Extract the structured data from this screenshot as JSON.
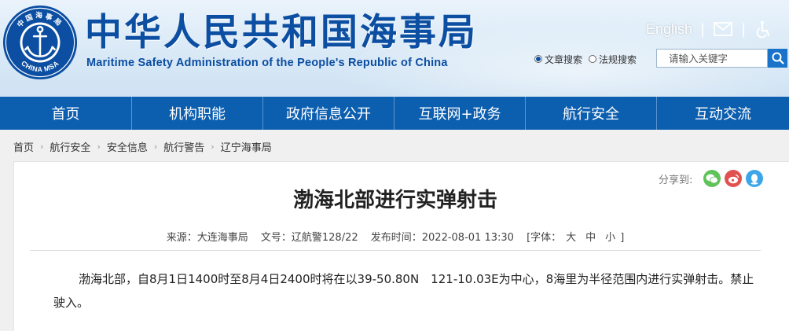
{
  "header": {
    "title_cn": "中华人民共和国海事局",
    "title_en": "Maritime Safety Administration of the People's Republic of China",
    "logo": {
      "top_text": "中国海事局",
      "bottom_text": "CHINA MSA",
      "icon": "anchor-icon"
    },
    "english_link": "English",
    "separator": "|",
    "mail_icon": "mail-icon",
    "accessibility_icon": "accessibility-icon",
    "search": {
      "options": [
        {
          "label": "文章搜索",
          "selected": true
        },
        {
          "label": "法规搜索",
          "selected": false
        }
      ],
      "placeholder": "请输入关键字",
      "button_icon": "search-icon"
    }
  },
  "nav": {
    "items": [
      {
        "label": "首页"
      },
      {
        "label": "机构职能"
      },
      {
        "label": "政府信息公开"
      },
      {
        "label": "互联网+政务"
      },
      {
        "label": "航行安全"
      },
      {
        "label": "互动交流"
      }
    ]
  },
  "breadcrumb": {
    "items": [
      "首页",
      "航行安全",
      "安全信息",
      "航行警告",
      "辽宁海事局"
    ],
    "separator": "›"
  },
  "article": {
    "share_label": "分享到:",
    "share_targets": [
      {
        "name": "wechat-icon",
        "color": "#5fc35a"
      },
      {
        "name": "weibo-icon",
        "color": "#e0514f"
      },
      {
        "name": "qq-icon",
        "color": "#3da6e8"
      }
    ],
    "title": "渤海北部进行实弹射击",
    "meta": {
      "source": "来源：大连海事局",
      "doc_no": "文号：辽航警128/22",
      "published": "发布时间：2022-08-01 13:30",
      "font_label_open": "[字体：",
      "font_large": "大",
      "font_medium": "中",
      "font_small": "小",
      "font_label_close": "]"
    },
    "body": "渤海北部，自8月1日1400时至8月4日2400时将在以39-50.80N　121-10.03E为中心，8海里为半径范围内进行实弹射击。禁止驶入。"
  },
  "colors": {
    "brand_blue": "#0b4ea2",
    "nav_blue": "#0c5eaf",
    "search_button": "#1a73c9"
  }
}
